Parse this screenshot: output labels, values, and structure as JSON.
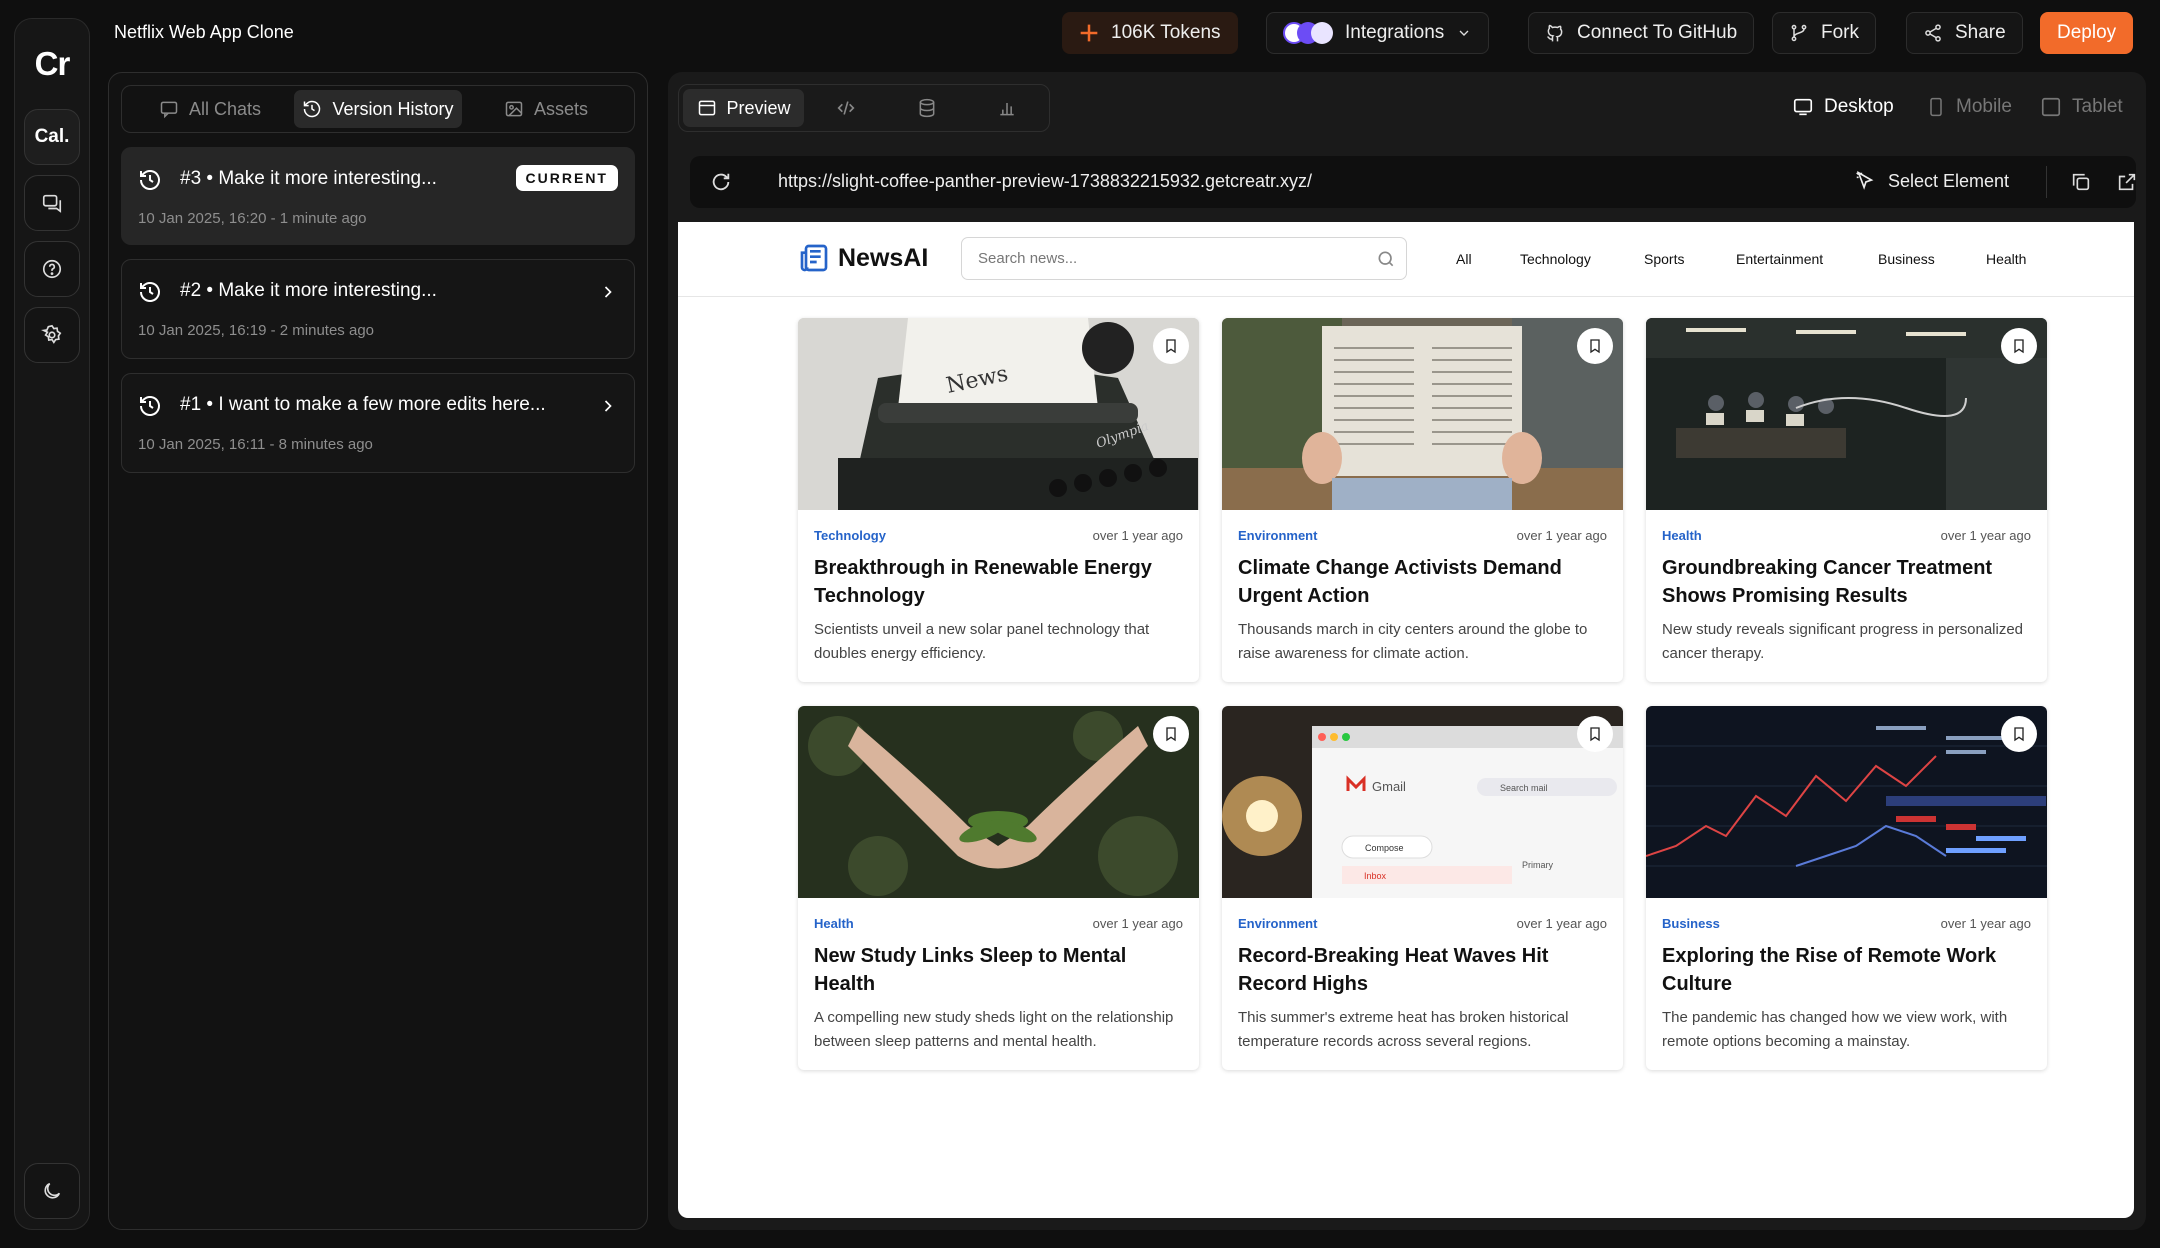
{
  "rail": {
    "logo": "Cr",
    "workspace_label": "Cal."
  },
  "topbar": {
    "project_title": "Netflix Web App Clone",
    "tokens": "106K Tokens",
    "integrations": "Integrations",
    "github": "Connect To GitHub",
    "fork": "Fork",
    "share": "Share",
    "deploy": "Deploy",
    "accent": "#f26b2a"
  },
  "panel": {
    "tabs": [
      {
        "label": "All Chats"
      },
      {
        "label": "Version History"
      },
      {
        "label": "Assets"
      }
    ],
    "versions": [
      {
        "title": "#3 • Make it more interesting...",
        "meta": "10 Jan 2025, 16:20 - 1 minute ago",
        "badge": "CURRENT"
      },
      {
        "title": "#2 • Make it more interesting...",
        "meta": "10 Jan 2025, 16:19 - 2 minutes ago"
      },
      {
        "title": "#1 • I want to make a few more edits here...",
        "meta": "10 Jan 2025, 16:11 - 8 minutes ago"
      }
    ]
  },
  "preview": {
    "tab_preview": "Preview",
    "devices": {
      "desktop": "Desktop",
      "mobile": "Mobile",
      "tablet": "Tablet"
    },
    "url": "https://slight-coffee-panther-preview-1738832215932.getcreatr.xyz/",
    "select_element": "Select Element"
  },
  "site": {
    "brand": "NewsAI",
    "search_placeholder": "Search news...",
    "nav": [
      "All",
      "Technology",
      "Sports",
      "Entertainment",
      "Business",
      "Health"
    ],
    "category_color": "#2563c9",
    "articles": [
      {
        "category": "Technology",
        "time": "over 1 year ago",
        "title": "Breakthrough in Renewable Energy Technology",
        "desc": "Scientists unveil a new solar panel technology that doubles energy efficiency."
      },
      {
        "category": "Environment",
        "time": "over 1 year ago",
        "title": "Climate Change Activists Demand Urgent Action",
        "desc": "Thousands march in city centers around the globe to raise awareness for climate action."
      },
      {
        "category": "Health",
        "time": "over 1 year ago",
        "title": "Groundbreaking Cancer Treatment Shows Promising Results",
        "desc": "New study reveals significant progress in personalized cancer therapy."
      },
      {
        "category": "Health",
        "time": "over 1 year ago",
        "title": "New Study Links Sleep to Mental Health",
        "desc": "A compelling new study sheds light on the relationship between sleep patterns and mental health."
      },
      {
        "category": "Environment",
        "time": "over 1 year ago",
        "title": "Record-Breaking Heat Waves Hit Record Highs",
        "desc": "This summer's extreme heat has broken historical temperature records across several regions."
      },
      {
        "category": "Business",
        "time": "over 1 year ago",
        "title": "Exploring the Rise of Remote Work Culture",
        "desc": "The pandemic has changed how we view work, with remote options becoming a mainstay."
      }
    ],
    "image_text": {
      "typewriter": "News",
      "brand_mark": "Olympia",
      "gmail": "Gmail",
      "compose": "Compose",
      "inbox": "Inbox",
      "primary": "Primary",
      "search_mail": "Search mail"
    }
  }
}
